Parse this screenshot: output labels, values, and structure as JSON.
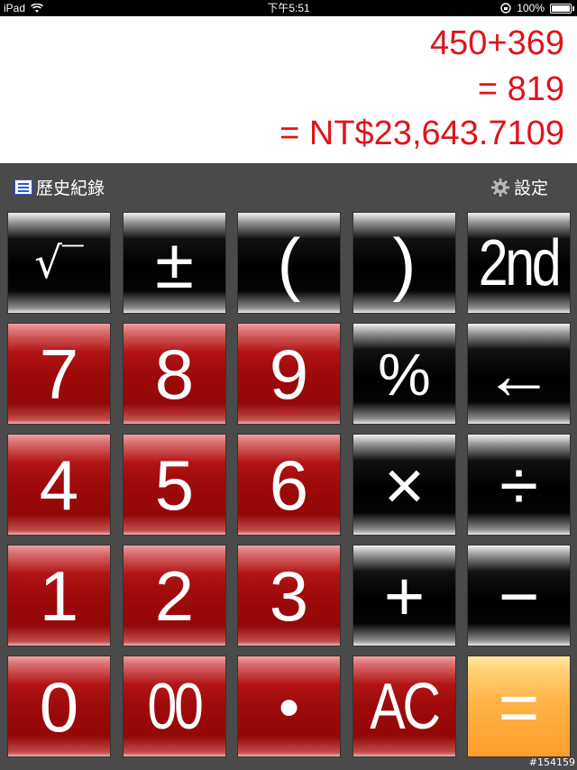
{
  "status_bar": {
    "device": "iPad",
    "time": "下午5:51",
    "battery": "100%"
  },
  "display": {
    "expression": "450+369",
    "result": "= 819",
    "converted": "= NT$23,643.7109"
  },
  "toolbar": {
    "history_label": "歷史紀錄",
    "settings_label": "設定"
  },
  "keys": {
    "sqrt": "√‾",
    "plus_minus": "±",
    "open_paren": "(",
    "close_paren": ")",
    "second": "2nd",
    "seven": "7",
    "eight": "8",
    "nine": "9",
    "percent": "%",
    "backspace": "←",
    "four": "4",
    "five": "5",
    "six": "6",
    "multiply": "×",
    "divide": "÷",
    "one": "1",
    "two": "2",
    "three": "3",
    "add": "+",
    "subtract": "−",
    "zero": "0",
    "double_zero": "00",
    "decimal": "•",
    "all_clear": "AC",
    "equals": "="
  },
  "colors": {
    "display_text": "#e0141c",
    "red_key": "#9e0a0a",
    "black_key": "#000000",
    "orange_key": "#ff9d2c"
  },
  "watermark": "#154159"
}
